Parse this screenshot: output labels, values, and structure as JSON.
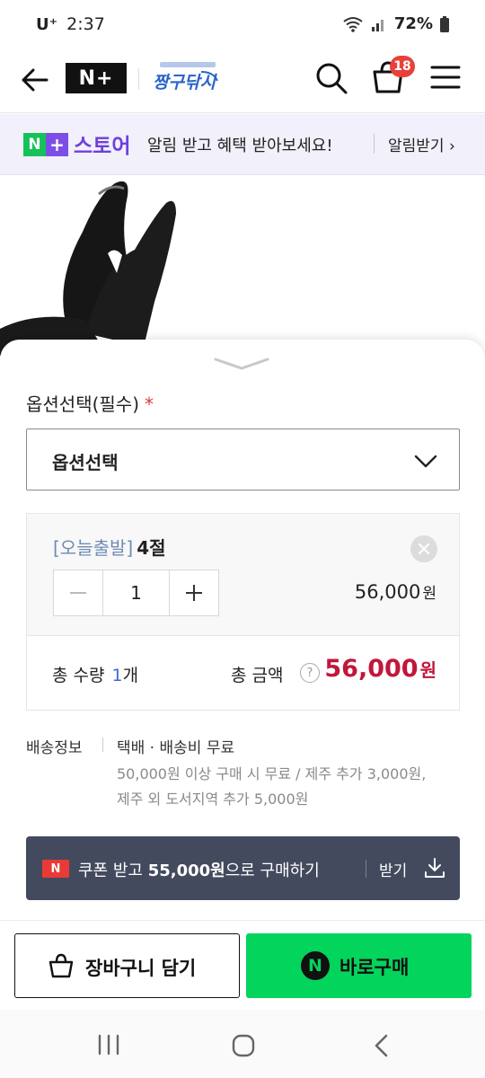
{
  "status_bar": {
    "carrier": "U⁺",
    "time": "2:37",
    "battery": "72%"
  },
  "header": {
    "logo_text": "N+",
    "store_logo_text": "짱구닦시"
  },
  "cart": {
    "badge_count": "18"
  },
  "banner": {
    "brand_n": "N",
    "brand_plus": "+",
    "brand_word": "스토어",
    "message": "알림 받고 혜택 받아보세요!",
    "cta": "알림받기 ›"
  },
  "options": {
    "label": "옵션선택(필수)",
    "required_mark": "*",
    "select_value": "옵션선택"
  },
  "item": {
    "tag": "[오늘출발]",
    "name": "4절",
    "quantity": "1",
    "price": "56,000",
    "price_unit": "원"
  },
  "total": {
    "qty_label": "총 수량",
    "qty_value": "1",
    "qty_unit": "개",
    "amount_label": "총 금액",
    "help": "?",
    "amount": "56,000",
    "amount_unit": "원"
  },
  "shipping": {
    "label": "배송정보",
    "main": "택배 · 배송비 무료",
    "line1": "50,000원 이상 구매 시 무료 / 제주 추가 3,000원,",
    "line2": "제주 외 도서지역 추가 5,000원"
  },
  "coupon": {
    "badge": "N",
    "text_pre": "쿠폰 받고 ",
    "text_amount": "55,000원",
    "text_post": "으로 구매하기",
    "get_label": "받기"
  },
  "actions": {
    "cart_label": "장바구니 담기",
    "buy_icon": "N",
    "buy_label": "바로구매"
  },
  "colors": {
    "accent_green": "#03d45c",
    "price_red": "#c1173b",
    "brand_purple": "#6e3fdc",
    "coupon_bg": "#444a5e"
  },
  "icons": [
    "back-arrow-icon",
    "search-icon",
    "shopping-bag-icon",
    "hamburger-menu-icon",
    "chevron-down-icon",
    "close-icon",
    "minus-icon",
    "plus-icon",
    "help-icon",
    "download-icon",
    "recents-icon",
    "home-icon",
    "back-icon"
  ]
}
